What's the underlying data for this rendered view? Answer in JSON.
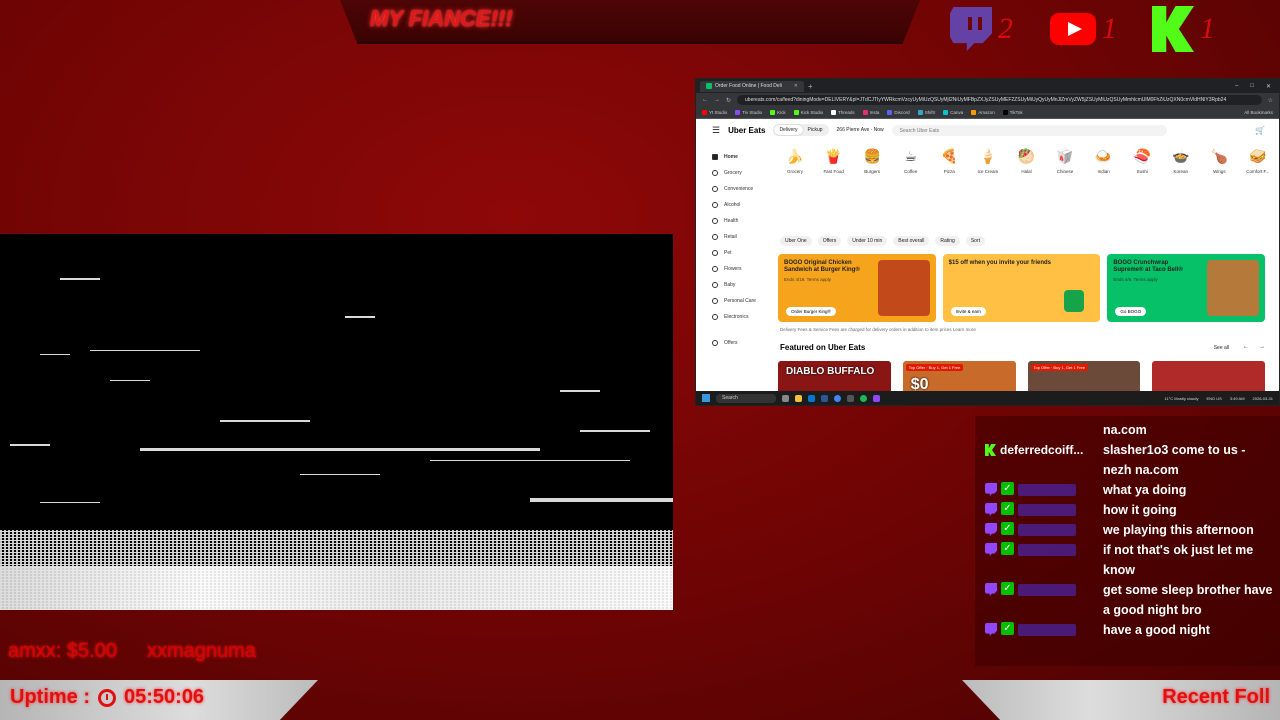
{
  "overlay": {
    "title": "MY FIANCE!!!",
    "counts": {
      "twitch": "2",
      "youtube": "1",
      "kick": "1"
    },
    "donations": [
      "amxx: $5.00",
      "xxmagnuma"
    ],
    "uptime_label": "Uptime :",
    "uptime_value": "05:50:06",
    "recent_label": "Recent Foll"
  },
  "browser": {
    "tab_title": "Order Food Online | Food Deli",
    "url": "ubereats.com/ca/feed?diningMode=DELIVERY&pl=JTdCJTIyYWRkcmVzcyUyMiUzQSUyMjI2NiUyMFBpZXJyZSUyMEF2ZSUyMiUyQyUyMnJlZmVyZW5jZSUyMiUzQSUyMmhlcmUlM0FhZiUzQXN0cmVldHNlY3Rpb24",
    "bookmarks": [
      "Yt Studio",
      "Tiv Studio",
      "Kick",
      "Kick Studio",
      "Threads",
      "Insta",
      "Discord",
      "Shiftr",
      "Canva",
      "Amazon",
      "TikTok",
      "All Bookmarks"
    ],
    "brand": "Uber Eats",
    "delivery": "Delivery",
    "pickup": "Pickup",
    "address": "266 Pierre Ave · Now",
    "search_placeholder": "Search Uber Eats",
    "sidebar": [
      "Home",
      "Grocery",
      "Convenience",
      "Alcohol",
      "Health",
      "Retail",
      "Pet",
      "Flowers",
      "Baby",
      "Personal Care",
      "Electronics",
      "Offers"
    ],
    "categories": [
      {
        "label": "Grocery",
        "icon": "🍌"
      },
      {
        "label": "Fast Food",
        "icon": "🍟"
      },
      {
        "label": "Burgers",
        "icon": "🍔"
      },
      {
        "label": "Coffee",
        "icon": "☕"
      },
      {
        "label": "Pizza",
        "icon": "🍕"
      },
      {
        "label": "Ice Cream",
        "icon": "🍦"
      },
      {
        "label": "Halal",
        "icon": "🥙"
      },
      {
        "label": "Chinese",
        "icon": "🥡"
      },
      {
        "label": "Indian",
        "icon": "🍛"
      },
      {
        "label": "Sushi",
        "icon": "🍣"
      },
      {
        "label": "Korean",
        "icon": "🍲"
      },
      {
        "label": "Wings",
        "icon": "🍗"
      },
      {
        "label": "Comfort F...",
        "icon": "🥪"
      }
    ],
    "filters": [
      "Uber One",
      "Offers",
      "Under 10 min",
      "Best overall",
      "Rating",
      "Sort"
    ],
    "promos": [
      {
        "title": "BOGO Original Chicken Sandwich at Burger King®",
        "sub": "Ends 4/19. Terms apply",
        "button": "Order Burger King®",
        "bg": "#f7a41d",
        "art": "#c24a1a"
      },
      {
        "title": "$15 off when you invite your friends",
        "sub": "",
        "button": "Invite & earn",
        "bg": "#ffc043",
        "art": "#16a34a"
      },
      {
        "title": "BOGO Crunchwrap Supreme® at Taco Bell®",
        "sub": "Ends 4/6. Terms apply",
        "button": "Go BOGO",
        "bg": "#06c167",
        "art": "#b5793a"
      }
    ],
    "fees_note": "Delivery Fees & Service Fees are charged for delivery orders in addition to item prices Learn more",
    "featured_title": "Featured on Uber Eats",
    "see_all": "See all",
    "tiles": [
      {
        "name": "DIABLO BUFFALO",
        "badge": "",
        "bg": "#8a1515"
      },
      {
        "name": "$0",
        "badge": "Top Offer · Buy 1, Get 1 Free",
        "bg": "#c86a2a"
      },
      {
        "name": "",
        "badge": "Top Offer · Buy 1, Get 1 Free",
        "bg": "#6b4a3a"
      },
      {
        "name": "",
        "badge": "",
        "bg": "#b02a2a"
      }
    ],
    "taskbar_search": "Search",
    "weather": "11°C Mostly cloudy",
    "lang": "ENG US",
    "time": "3:49 AM",
    "date": "2026-03-31"
  },
  "chat": [
    {
      "platform": "none",
      "user": "",
      "text": "na.com"
    },
    {
      "platform": "kick",
      "user": "deferredcoiff...",
      "text": "slasher1o3 come to us - nezh na.com"
    },
    {
      "platform": "twitch",
      "user": "hidden",
      "text": "what ya doing"
    },
    {
      "platform": "twitch",
      "user": "hidden",
      "text": "how it going"
    },
    {
      "platform": "twitch",
      "user": "hidden",
      "text": "we playing this afternoon"
    },
    {
      "platform": "twitch",
      "user": "hidden",
      "text": "if not that's ok just let me know"
    },
    {
      "platform": "twitch",
      "user": "hidden",
      "text": "get some sleep brother have a good night bro"
    },
    {
      "platform": "twitch",
      "user": "hidden",
      "text": "have a good night"
    }
  ]
}
